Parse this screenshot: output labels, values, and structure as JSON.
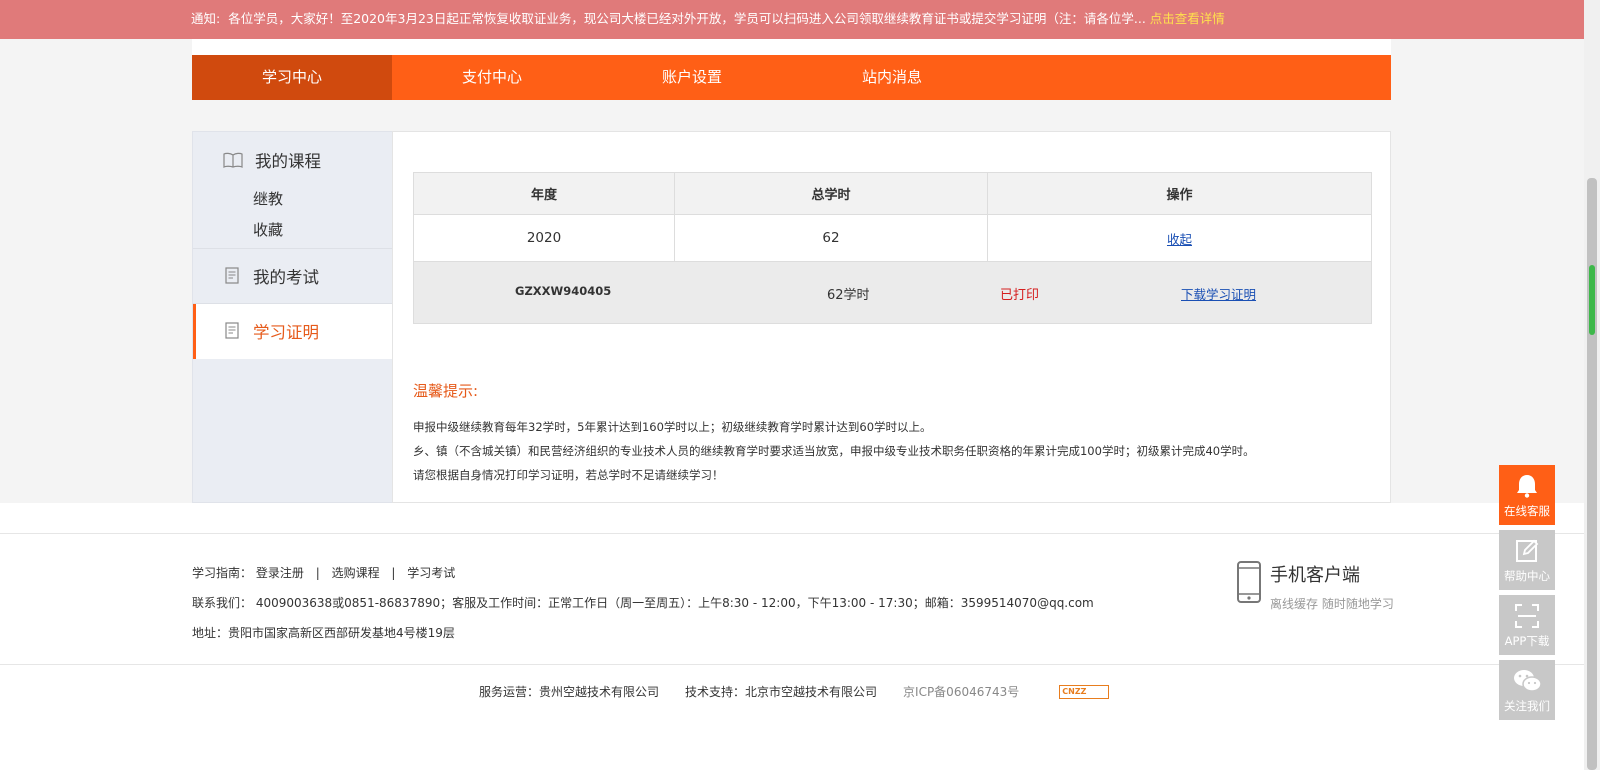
{
  "notice": {
    "prefix": "通知:",
    "text": "各位学员，大家好！至2020年3月23日起正常恢复收取证业务，现公司大楼已经对外开放，学员可以扫码进入公司领取继续教育证书或提交学习证明（注：请各位学...",
    "detail_link": "点击查看详情"
  },
  "nav": {
    "tabs": [
      "学习中心",
      "支付中心",
      "账户设置",
      "站内消息"
    ],
    "active": "学习中心"
  },
  "sidebar": {
    "my_courses": "我的课程",
    "sub_items": [
      "继教",
      "收藏"
    ],
    "my_exams": "我的考试",
    "certificate": "学习证明"
  },
  "table": {
    "headers": [
      "年度",
      "总学时",
      "操作"
    ],
    "rows": [
      {
        "year": "2020",
        "hours": "62",
        "action": "收起"
      }
    ]
  },
  "cert": {
    "code": "GZXXW940405",
    "hours": "62学时",
    "status": "已打印",
    "download": "下载学习证明"
  },
  "tips": {
    "title": "温馨提示:",
    "lines": [
      "申报中级继续教育每年32学时，5年累计达到160学时以上；初级继续教育学时累计达到60学时以上。",
      "乡、镇（不含城关镇）和民营经济组织的专业技术人员的继续教育学时要求适当放宽，申报中级专业技术职务任职资格的年累计完成100学时；初级累计完成40学时。",
      "请您根据自身情况打印学习证明，若总学时不足请继续学习！"
    ]
  },
  "footer": {
    "guide_label": "学习指南：",
    "guide_links": [
      "登录注册",
      "选购课程",
      "学习考试"
    ],
    "separator": "|",
    "contact": "联系我们：  4009003638或0851-86837890；客服及工作时间：正常工作日（周一至周五）：上午8:30 - 12:00，下午13:00 - 17:30；邮箱：3599514070@qq.com",
    "address": "地址：贵阳市国家高新区西部研发基地4号楼19层",
    "mobile_title": "手机客户端",
    "mobile_sub": "离线缓存 随时随地学习",
    "operator": "服务运营：贵州空越技术有限公司",
    "support": "技术支持：北京市空越技术有限公司",
    "icp": "京ICP备06046743号",
    "cnzz": "CNZZ"
  },
  "floating": [
    "在线客服",
    "帮助中心",
    "APP下载",
    "关注我们"
  ],
  "colors": {
    "accent": "#ff5f16",
    "notice_bg": "#e07a7a",
    "link": "#1a4fb4",
    "printed": "#d62020"
  }
}
